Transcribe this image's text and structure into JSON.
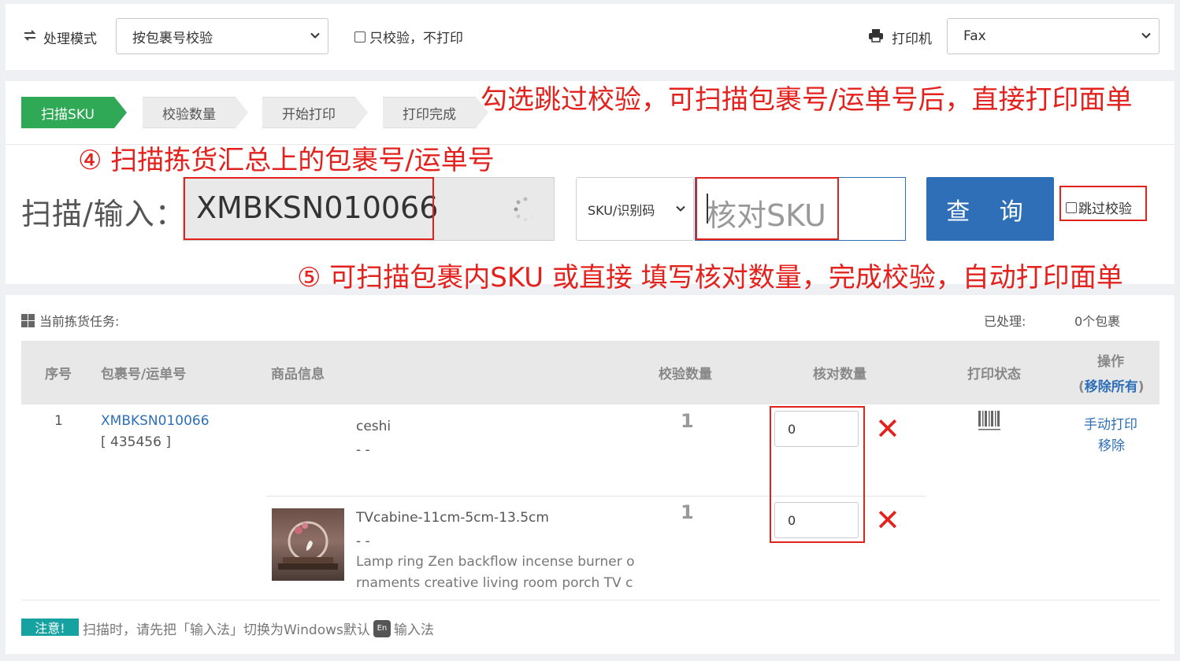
{
  "topbar": {
    "mode_label": "处理模式",
    "mode_select": "按包裹号校验",
    "only_check_label": "只校验，不打印",
    "printer_label": "打印机",
    "printer_select": "Fax"
  },
  "steps": [
    {
      "label": "扫描SKU",
      "active": true
    },
    {
      "label": "校验数量",
      "active": false
    },
    {
      "label": "开始打印",
      "active": false
    },
    {
      "label": "打印完成",
      "active": false
    }
  ],
  "annotations": {
    "skip_hint": "勾选跳过校验，可扫描包裹号/运单号后，直接打印面单",
    "step4": "④ 扫描拣货汇总上的包裹号/运单号",
    "step5": "⑤ 可扫描包裹内SKU 或直接 填写核对数量，完成校验，自动打印面单"
  },
  "scan": {
    "label": "扫描/输入：",
    "value": "XMBKSN010066",
    "sku_select": "SKU/识别码",
    "sku_placeholder": "核对SKU",
    "query_button": "查 询",
    "skip_label": "跳过校验"
  },
  "task": {
    "title": "当前拣货任务:",
    "processed_label": "已处理:",
    "processed_value": "0个包裹"
  },
  "table": {
    "headers": {
      "index": "序号",
      "package": "包裹号/运单号",
      "product": "商品信息",
      "check_qty": "校验数量",
      "verify_qty": "核对数量",
      "print_status": "打印状态",
      "ops": "操作",
      "ops_open": "(",
      "remove_all": "移除所有",
      "ops_close": ")"
    },
    "rows": [
      {
        "index": "1",
        "package": "XMBKSN010066",
        "package_sub": "[ 435456 ]",
        "items": [
          {
            "name": "ceshi",
            "sku": "- -",
            "desc1": "",
            "desc2": "",
            "check_qty": "1",
            "verify_qty": "0"
          },
          {
            "name": "TVcabine-11cm-5cm-13.5cm",
            "sku": "- -",
            "desc1": "Lamp ring Zen backflow incense burner o",
            "desc2": "rnaments creative living room porch TV c",
            "check_qty": "1",
            "verify_qty": "0"
          }
        ],
        "ops": [
          "手动打印",
          "移除"
        ]
      }
    ]
  },
  "notice": {
    "badge": "注意!",
    "text_before": "扫描时，请先把「输入法」切换为Windows默认",
    "en_badge": "En",
    "text_after": "输入法"
  },
  "colors": {
    "primary": "#2e6fb8",
    "step_active": "#2fa955",
    "annotation": "#e3211d",
    "notice": "#17a2a2"
  },
  "icons": [
    "swap-icon",
    "chevron-down-icon",
    "printer-icon",
    "spinner-icon",
    "grid-icon",
    "barcode-icon",
    "close-icon"
  ]
}
